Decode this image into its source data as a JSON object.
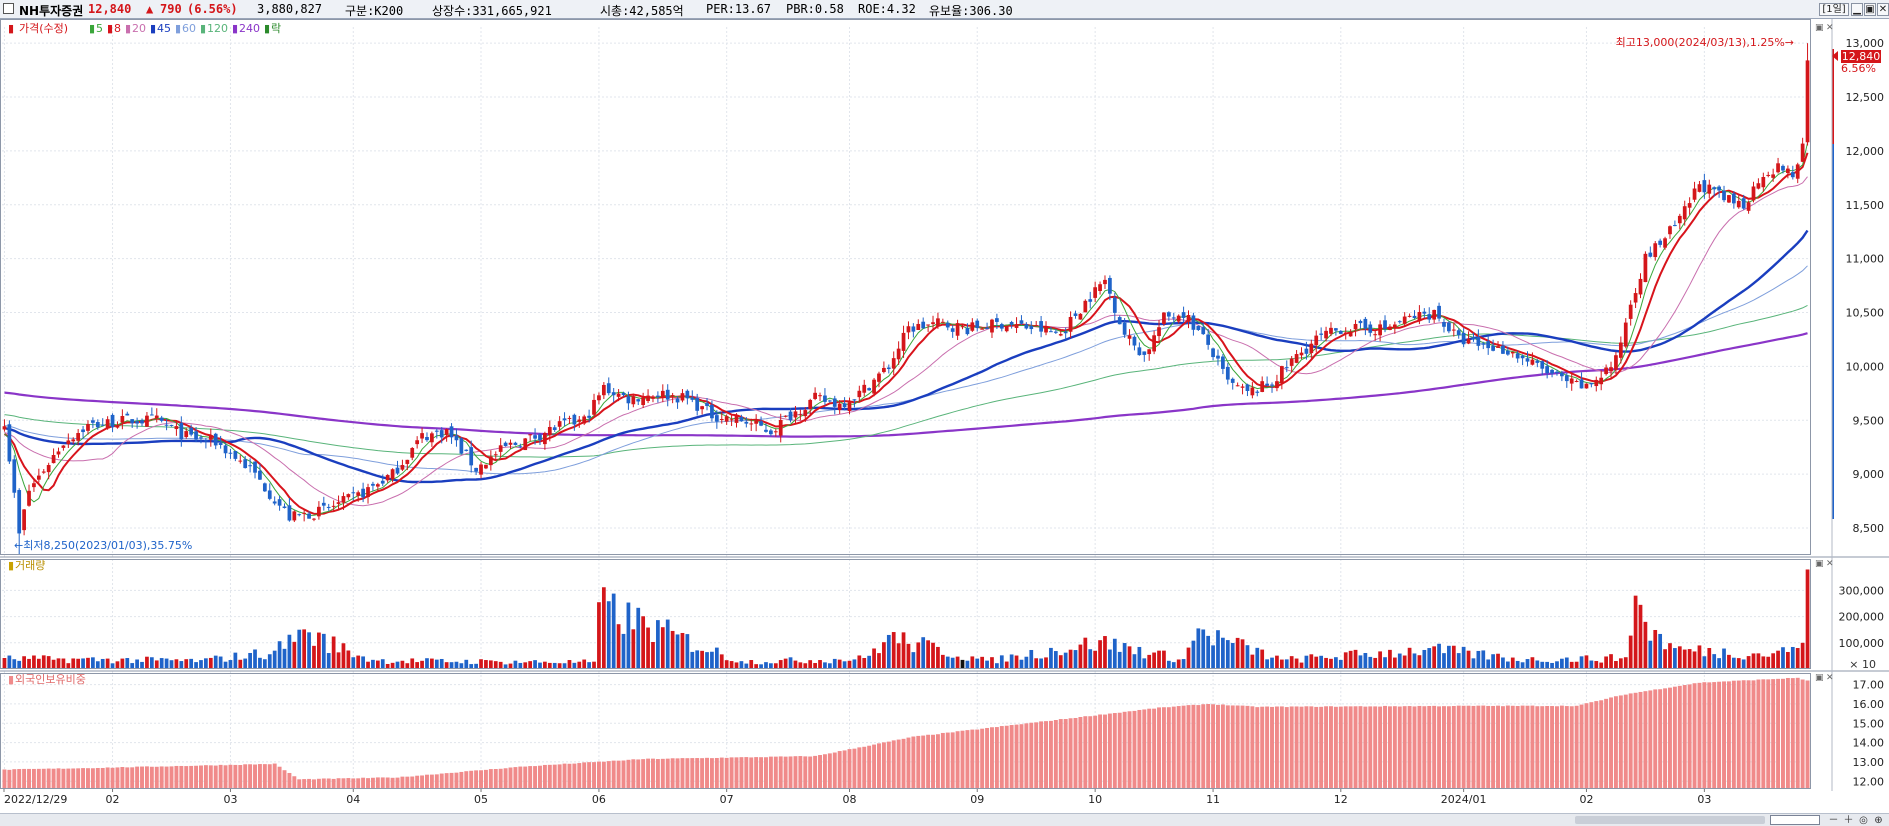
{
  "header": {
    "name": "NH투자증권",
    "price": "12,840",
    "change_arrow": "▲",
    "change": "790",
    "change_pct": "(6.56%)",
    "volume": "3,880,827",
    "market": "구분:K200",
    "listed": "상장수:331,665,921",
    "mktcap": "시총:42,585억",
    "per": "PER:13.67",
    "pbr": "PBR:0.58",
    "roe": "ROE:4.32",
    "reserve": "유보율:306.30",
    "period_button": "[1일]",
    "minimize_icon": "▁",
    "restore_icon": "▣",
    "close_icon": "✕"
  },
  "colors": {
    "up": "#d4161a",
    "down": "#1f63c9",
    "ma5": "#3aa63a",
    "ma8": "#d8141c",
    "ma20": "#c96fae",
    "ma45": "#1a3ebf",
    "ma60": "#7f9fdc",
    "ma120": "#59b47a",
    "ma240": "#8a35c8",
    "foreign": "#f08a8a"
  },
  "price_panel": {
    "legend": [
      {
        "label": "가격(수정)",
        "color": "#d4161a"
      },
      {
        "label": "5",
        "color": "#3aa63a"
      },
      {
        "label": "8",
        "color": "#d8141c"
      },
      {
        "label": "20",
        "color": "#c96fae"
      },
      {
        "label": "45",
        "color": "#1a3ebf"
      },
      {
        "label": "60",
        "color": "#7f9fdc"
      },
      {
        "label": "120",
        "color": "#59b47a"
      },
      {
        "label": "240",
        "color": "#8a35c8"
      },
      {
        "label": "락",
        "color": "#2b8a2b"
      }
    ],
    "high_note": "최고13,000(2024/03/13),1.25%→",
    "low_note": "←최저8,250(2023/01/03),35.75%",
    "current_label": "12,840",
    "current_pct": "6.56%",
    "y_ticks": [
      "13,000",
      "12,500",
      "12,000",
      "11,500",
      "11,000",
      "10,500",
      "10,000",
      "9,500",
      "9,000",
      "8,500"
    ]
  },
  "volume_panel": {
    "title": "거래량",
    "y_ticks": [
      "300,000",
      "200,000",
      "100,000"
    ],
    "multiplier": "× 10"
  },
  "foreign_panel": {
    "title": "외국인보유비중",
    "y_ticks": [
      "17.00",
      "16.00",
      "15.00",
      "14.00",
      "13.00",
      "12.00"
    ]
  },
  "x_labels": [
    "2022/12/29",
    "02",
    "03",
    "04",
    "05",
    "06",
    "07",
    "08",
    "09",
    "10",
    "11",
    "12",
    "2024/01",
    "02",
    "03"
  ],
  "chart_data": {
    "type": "candlestick",
    "title": "NH투자증권",
    "x_range": [
      "2022/12/29",
      "2024/03/13"
    ],
    "y_range": [
      8250,
      13150
    ],
    "monthly_close": [
      {
        "month": "2022/12",
        "close": 9500
      },
      {
        "month": "2023/01",
        "close": 9400
      },
      {
        "month": "2023/02",
        "close": 9300
      },
      {
        "month": "2023/03",
        "close": 8600
      },
      {
        "month": "2023/04",
        "close": 9200
      },
      {
        "month": "2023/05",
        "close": 9500
      },
      {
        "month": "2023/06",
        "close": 9700
      },
      {
        "month": "2023/07",
        "close": 9600
      },
      {
        "month": "2023/08",
        "close": 10400
      },
      {
        "month": "2023/09",
        "close": 10700
      },
      {
        "month": "2023/10",
        "close": 9800
      },
      {
        "month": "2023/11",
        "close": 10400
      },
      {
        "month": "2023/12",
        "close": 10300
      },
      {
        "month": "2024/01",
        "close": 9800
      },
      {
        "month": "2024/02",
        "close": 11600
      },
      {
        "month": "2024/03",
        "close": 12840
      }
    ],
    "price_anchors": [
      [
        0,
        9500
      ],
      [
        3,
        8450
      ],
      [
        5,
        8850
      ],
      [
        12,
        9300
      ],
      [
        17,
        9450
      ],
      [
        25,
        9500
      ],
      [
        31,
        9500
      ],
      [
        37,
        9350
      ],
      [
        43,
        9300
      ],
      [
        50,
        9050
      ],
      [
        58,
        8600
      ],
      [
        64,
        8650
      ],
      [
        72,
        8800
      ],
      [
        79,
        9000
      ],
      [
        85,
        9350
      ],
      [
        90,
        9400
      ],
      [
        96,
        9050
      ],
      [
        102,
        9250
      ],
      [
        108,
        9350
      ],
      [
        113,
        9450
      ],
      [
        118,
        9500
      ],
      [
        122,
        9800
      ],
      [
        127,
        9700
      ],
      [
        133,
        9750
      ],
      [
        139,
        9700
      ],
      [
        144,
        9550
      ],
      [
        150,
        9500
      ],
      [
        156,
        9400
      ],
      [
        160,
        9550
      ],
      [
        165,
        9700
      ],
      [
        170,
        9650
      ],
      [
        174,
        9750
      ],
      [
        180,
        10000
      ],
      [
        184,
        10350
      ],
      [
        190,
        10400
      ],
      [
        196,
        10350
      ],
      [
        203,
        10400
      ],
      [
        210,
        10350
      ],
      [
        215,
        10300
      ],
      [
        220,
        10600
      ],
      [
        224,
        10800
      ],
      [
        228,
        10300
      ],
      [
        232,
        10100
      ],
      [
        236,
        10450
      ],
      [
        240,
        10500
      ],
      [
        245,
        10200
      ],
      [
        249,
        9850
      ],
      [
        253,
        9750
      ],
      [
        258,
        9850
      ],
      [
        262,
        10050
      ],
      [
        267,
        10250
      ],
      [
        272,
        10350
      ],
      [
        277,
        10350
      ],
      [
        281,
        10350
      ],
      [
        286,
        10450
      ],
      [
        291,
        10500
      ],
      [
        296,
        10250
      ],
      [
        300,
        10200
      ],
      [
        306,
        10150
      ],
      [
        312,
        10000
      ],
      [
        318,
        9850
      ],
      [
        322,
        9800
      ],
      [
        328,
        10050
      ],
      [
        331,
        10600
      ],
      [
        334,
        11000
      ],
      [
        337,
        11150
      ],
      [
        341,
        11350
      ],
      [
        345,
        11700
      ],
      [
        350,
        11550
      ],
      [
        354,
        11500
      ],
      [
        358,
        11800
      ],
      [
        362,
        11850
      ],
      [
        364,
        11750
      ],
      [
        366,
        12050
      ],
      [
        367,
        12840
      ]
    ],
    "volume_anchors": [
      [
        0,
        42000
      ],
      [
        12,
        40000
      ],
      [
        40,
        34000
      ],
      [
        55,
        70000
      ],
      [
        60,
        150000
      ],
      [
        62,
        140000
      ],
      [
        75,
        35000
      ],
      [
        100,
        30000
      ],
      [
        120,
        28000
      ],
      [
        121,
        255000
      ],
      [
        150,
        30000
      ],
      [
        175,
        42000
      ],
      [
        180,
        130000
      ],
      [
        200,
        32000
      ],
      [
        223,
        110000
      ],
      [
        240,
        38000
      ],
      [
        243,
        155000
      ],
      [
        260,
        36000
      ],
      [
        290,
        80000
      ],
      [
        310,
        38000
      ],
      [
        330,
        45000
      ],
      [
        332,
        280000
      ],
      [
        334,
        180000
      ],
      [
        340,
        80000
      ],
      [
        360,
        60000
      ],
      [
        366,
        100000
      ],
      [
        367,
        380000
      ]
    ],
    "foreign_anchors": [
      [
        0,
        12.6
      ],
      [
        20,
        12.7
      ],
      [
        55,
        12.9
      ],
      [
        60,
        12.1
      ],
      [
        80,
        12.2
      ],
      [
        105,
        12.75
      ],
      [
        130,
        13.15
      ],
      [
        165,
        13.3
      ],
      [
        185,
        14.3
      ],
      [
        215,
        15.2
      ],
      [
        235,
        15.8
      ],
      [
        245,
        16.0
      ],
      [
        255,
        15.85
      ],
      [
        300,
        15.9
      ],
      [
        320,
        15.9
      ],
      [
        330,
        16.5
      ],
      [
        345,
        17.1
      ],
      [
        365,
        17.35
      ],
      [
        367,
        17.2
      ]
    ],
    "moving_averages": [
      "5",
      "8",
      "20",
      "45",
      "60",
      "120",
      "240"
    ]
  }
}
